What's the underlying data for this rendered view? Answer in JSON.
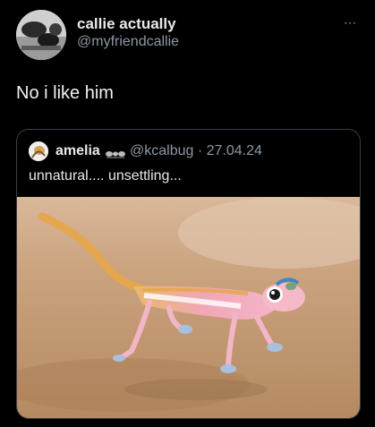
{
  "author": {
    "display_name": "callie actually",
    "handle": "@myfriendcallie"
  },
  "more_icon": "⋯",
  "tweet_text": "No i like him",
  "quoted": {
    "display_name": "amelia",
    "name_emoji": "ant-emoji",
    "handle": "@kcalbug",
    "separator": "·",
    "date": "27.04.24",
    "text": "unnatural.... unsettling..."
  },
  "colors": {
    "background": "#000000",
    "primary_text": "#e7e9ea",
    "secondary_text": "#8b98a5",
    "border": "#3a3f44"
  }
}
